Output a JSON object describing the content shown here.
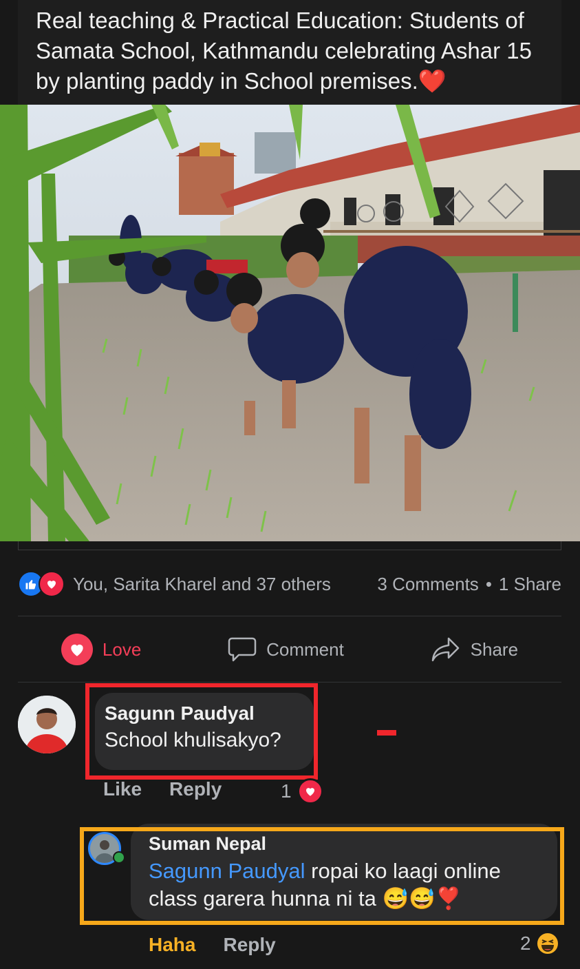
{
  "post": {
    "caption": "Real teaching & Practical Education: Students of Samata School, Kathmandu celebrating Ashar 15 by planting paddy in School premises.",
    "caption_emoji": "❤️"
  },
  "stats": {
    "reactors": "You, Sarita Kharel and 37 others",
    "comments": "3 Comments",
    "separator": "•",
    "shares": "1 Share"
  },
  "actions": {
    "love": "Love",
    "comment": "Comment",
    "share": "Share"
  },
  "comments": [
    {
      "author": "Sagunn Paudyal",
      "text": "School khulisakyo?",
      "like_label": "Like",
      "reply_label": "Reply",
      "reaction_count": "1"
    },
    {
      "author": "Suman Nepal",
      "mention": "Sagunn Paudyal",
      "text": " ropai ko laagi online class garera hunna ni ta ",
      "emojis": "😅😅❣️",
      "reaction_label": "Haha",
      "reply_label": "Reply",
      "reaction_count": "2"
    }
  ],
  "colors": {
    "love": "#f33e58",
    "like": "#1877f2",
    "mention": "#4599ff",
    "highlight_red": "#f0262c",
    "highlight_orange": "#f6a81a"
  },
  "icons": [
    "like-reaction-icon",
    "love-reaction-icon",
    "heart-icon",
    "comment-icon",
    "share-arrow-icon",
    "haha-emoji-icon"
  ]
}
